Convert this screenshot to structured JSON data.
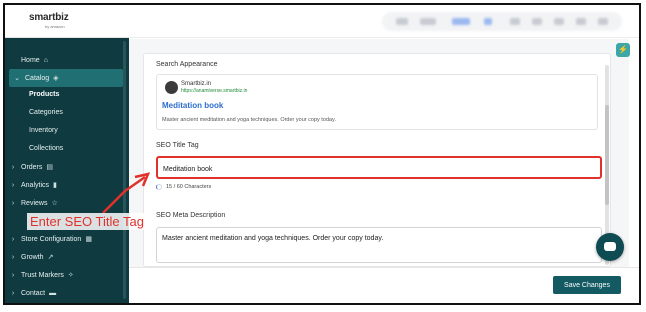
{
  "app": {
    "logo": "smartbiz",
    "logo_sub": "by amazon"
  },
  "sidebar": {
    "items": [
      {
        "label": "Home",
        "icon": "home-icon"
      },
      {
        "label": "Catalog",
        "icon": "cube-icon"
      },
      {
        "label": "Orders",
        "icon": "clipboard-icon"
      },
      {
        "label": "Analytics",
        "icon": "bar-chart-icon"
      },
      {
        "label": "Reviews",
        "icon": "star-icon"
      },
      {
        "label": "Store Configuration",
        "icon": "store-icon"
      },
      {
        "label": "Growth",
        "icon": "trend-up-icon"
      },
      {
        "label": "Trust Markers",
        "icon": "badge-icon"
      },
      {
        "label": "Contact",
        "icon": "chat-icon"
      }
    ],
    "catalog_sub": [
      "Products",
      "Categories",
      "Inventory",
      "Collections"
    ]
  },
  "search_appearance": {
    "heading": "Search Appearance",
    "site_name": "Smartbiz.in",
    "site_url": "https://anamiverse.smartbiz.in",
    "title": "Meditation book",
    "description": "Master ancient meditation and yoga techniques. Order your copy today."
  },
  "seo_title": {
    "label": "SEO Title Tag",
    "value": "Meditation book",
    "counter": "15 / 60 Characters"
  },
  "seo_meta": {
    "label": "SEO Meta Description",
    "value": "Master ancient meditation and yoga techniques. Order your copy today."
  },
  "footer": {
    "save_label": "Save Changes"
  },
  "annotation": {
    "text": "Enter SEO Title Tag",
    "color": "#e0322b"
  },
  "colors": {
    "sidebar_bg": "#0e3a40",
    "accent": "#145a63",
    "link": "#2d6ecf",
    "highlight": "#e0322b"
  }
}
